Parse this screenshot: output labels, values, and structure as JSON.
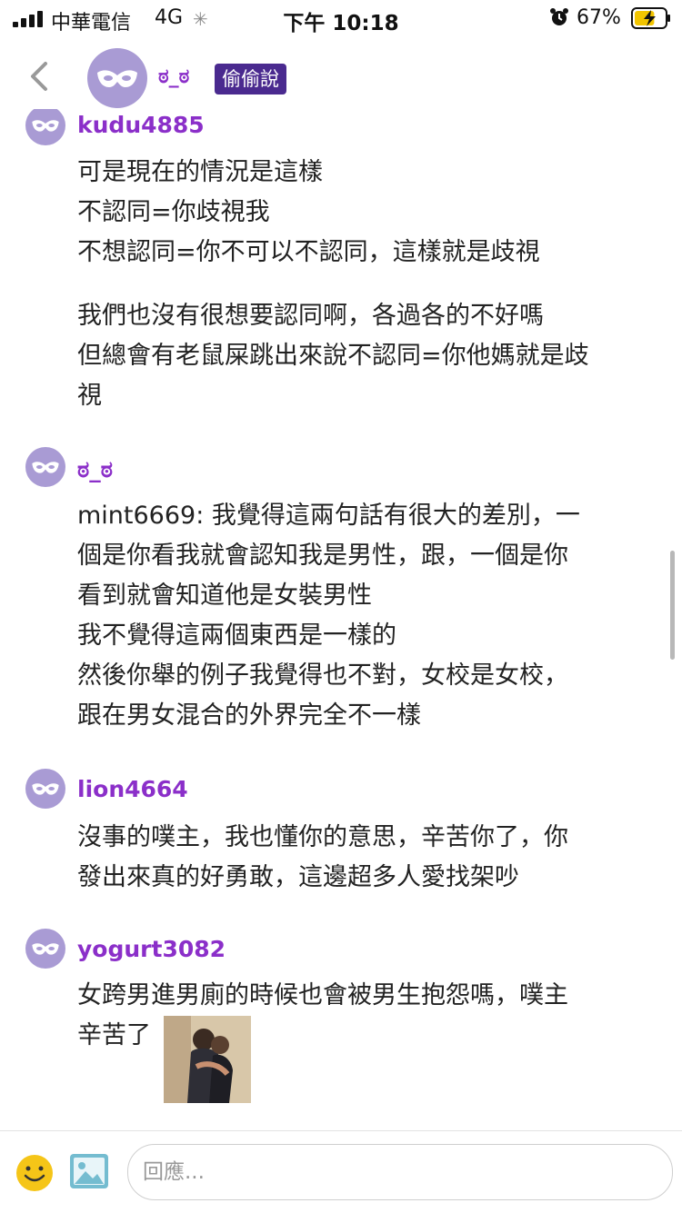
{
  "status_bar": {
    "carrier": "中華電信",
    "network": "4G",
    "time": "下午 10:18",
    "battery_percent": "67%",
    "battery_level": 0.67,
    "icons": [
      "signal-icon",
      "loading-icon",
      "alarm-icon",
      "battery-charging-icon"
    ]
  },
  "header": {
    "name": "ಠ_ಠ",
    "badge": "偷偷說",
    "icons": [
      "back-chevron-icon",
      "mask-icon"
    ]
  },
  "posts": [
    {
      "user": "kudu4885",
      "lines": [
        "可是現在的情況是這樣",
        "不認同=你歧視我",
        "不想認同=你不可以不認同，這樣就是歧視",
        "",
        "我們也沒有很想要認同啊，各過各的不好嗎",
        "但總會有老鼠屎跳出來說不認同=你他媽就是歧",
        "視"
      ]
    },
    {
      "user": "ಠ_ಠ",
      "lines": [
        "mint6669: 我覺得這兩句話有很大的差別，一",
        "個是你看我就會認知我是男性，跟，一個是你",
        "看到就會知道他是女裝男性",
        "我不覺得這兩個東西是一樣的",
        "然後你舉的例子我覺得也不對，女校是女校，",
        "跟在男女混合的外界完全不一樣"
      ]
    },
    {
      "user": "lion4664",
      "lines": [
        "沒事的噗主，我也懂你的意思，辛苦你了，你",
        "發出來真的好勇敢，這邊超多人愛找架吵"
      ]
    },
    {
      "user": "yogurt3082",
      "lines": [
        "女跨男進男廁的時候也會被男生抱怨嗎，噗主",
        "辛苦了"
      ]
    }
  ],
  "reply_bar": {
    "placeholder": "回應...",
    "icons": [
      "emoji-icon",
      "image-icon"
    ]
  },
  "colors": {
    "username": "#8b2fc9",
    "badge_bg": "#4a2a8f",
    "avatar": "#a99bd4",
    "emoji": "#f5c518",
    "image_icon": "#74bcd0"
  }
}
